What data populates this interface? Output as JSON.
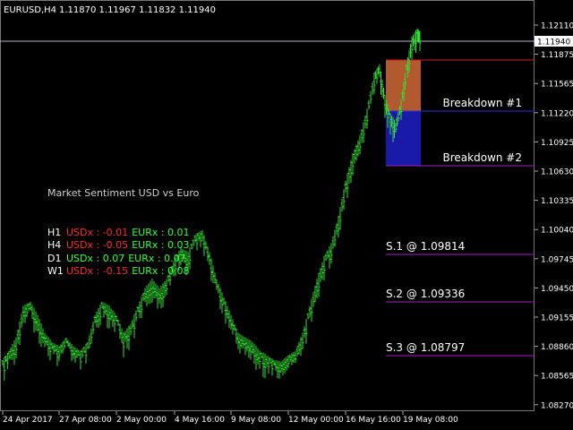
{
  "header": {
    "symbol": "EURUSD,H4",
    "ohlc": "1.11870 1.11967 1.11832 1.11940"
  },
  "price_axis": {
    "labels": [
      "1.12110",
      "1.11875",
      "1.11565",
      "1.11220",
      "1.10925",
      "1.10630",
      "1.10335",
      "1.10040",
      "1.09745",
      "1.09450",
      "1.09155",
      "1.08860",
      "1.08565",
      "1.08270"
    ],
    "current_price": "1.11940"
  },
  "time_axis": {
    "labels": [
      "24 Apr 2017",
      "27 Apr 08:00",
      "2 May 00:00",
      "4 May 16:00",
      "9 May 08:00",
      "12 May 00:00",
      "16 May 16:00",
      "19 May 08:00"
    ]
  },
  "sentiment": {
    "title": "Market Sentiment USD vs Euro",
    "rows": [
      {
        "tf": "H1",
        "usd": "USDx : -0.01",
        "eur": "EURx : 0.01",
        "usd_color": "#ff2a2a",
        "eur_color": "#33ff33"
      },
      {
        "tf": "H4",
        "usd": "USDx : -0.05",
        "eur": "EURx : 0.03",
        "usd_color": "#ff2a2a",
        "eur_color": "#33ff33"
      },
      {
        "tf": "D1",
        "usd": "USDx : 0.07",
        "eur": "EURx : 0.07",
        "usd_color": "#33ff33",
        "eur_color": "#33ff33"
      },
      {
        "tf": "W1",
        "usd": "USDx : -0.15",
        "eur": "EURx : 0.08",
        "usd_color": "#ff2a2a",
        "eur_color": "#33ff33"
      }
    ]
  },
  "levels": {
    "breakdown1": "Breakdown #1",
    "breakdown2": "Breakdown #2",
    "s1": "S.1 @ 1.09814",
    "s2": "S.2 @ 1.09336",
    "s3": "S.3 @ 1.08797"
  },
  "colors": {
    "background": "#000000",
    "candle": "#33dd33",
    "grid_line": "#b0b8c8",
    "upper_box": "#b15a30",
    "lower_box": "#1a1aa8",
    "red_line": "#d02020",
    "blue_line": "#3030e0",
    "support_line": "#a020c0"
  }
}
